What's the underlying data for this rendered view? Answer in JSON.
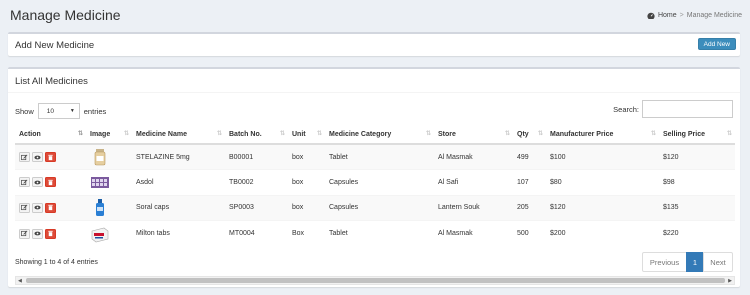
{
  "page": {
    "title": "Manage Medicine",
    "breadcrumb": {
      "home": "Home",
      "separator": ">",
      "current": "Manage Medicine"
    }
  },
  "add_box": {
    "title": "Add New Medicine",
    "add_button": "Add New"
  },
  "list_box": {
    "title": "List All Medicines",
    "show_label": "Show",
    "entries_label": "entries",
    "length_value": "10",
    "search_label": "Search:",
    "search_value": ""
  },
  "table": {
    "columns": [
      "Action",
      "Image",
      "Medicine Name",
      "Batch No.",
      "Unit",
      "Medicine Category",
      "Store",
      "Qty",
      "Manufacturer Price",
      "Selling Price"
    ],
    "rows": [
      {
        "image": "medicine-bottle-icon",
        "name": "STELAZINE 5mg",
        "batch": "B00001",
        "unit": "box",
        "category": "Tablet",
        "store": "Al Masmak",
        "qty": "499",
        "mprice": "$100",
        "sprice": "$120"
      },
      {
        "image": "medicine-pack-icon",
        "name": "Asdol",
        "batch": "TB0002",
        "unit": "box",
        "category": "Capsules",
        "store": "Al Safi",
        "qty": "107",
        "mprice": "$80",
        "sprice": "$98"
      },
      {
        "image": "medicine-spray-icon",
        "name": "Soral caps",
        "batch": "SP0003",
        "unit": "box",
        "category": "Capsules",
        "store": "Lantern Souk",
        "qty": "205",
        "mprice": "$120",
        "sprice": "$135"
      },
      {
        "image": "medicine-box-icon",
        "name": "Milton tabs",
        "batch": "MT0004",
        "unit": "Box",
        "category": "Tablet",
        "store": "Al Masmak",
        "qty": "500",
        "mprice": "$200",
        "sprice": "$220"
      }
    ]
  },
  "footer": {
    "info": "Showing 1 to 4 of 4 entries",
    "prev": "Previous",
    "page": "1",
    "next": "Next"
  },
  "colors": {
    "primary": "#3c8dbc",
    "danger": "#dd4b39",
    "page_active": "#337ab7",
    "background": "#ecf0f5"
  }
}
